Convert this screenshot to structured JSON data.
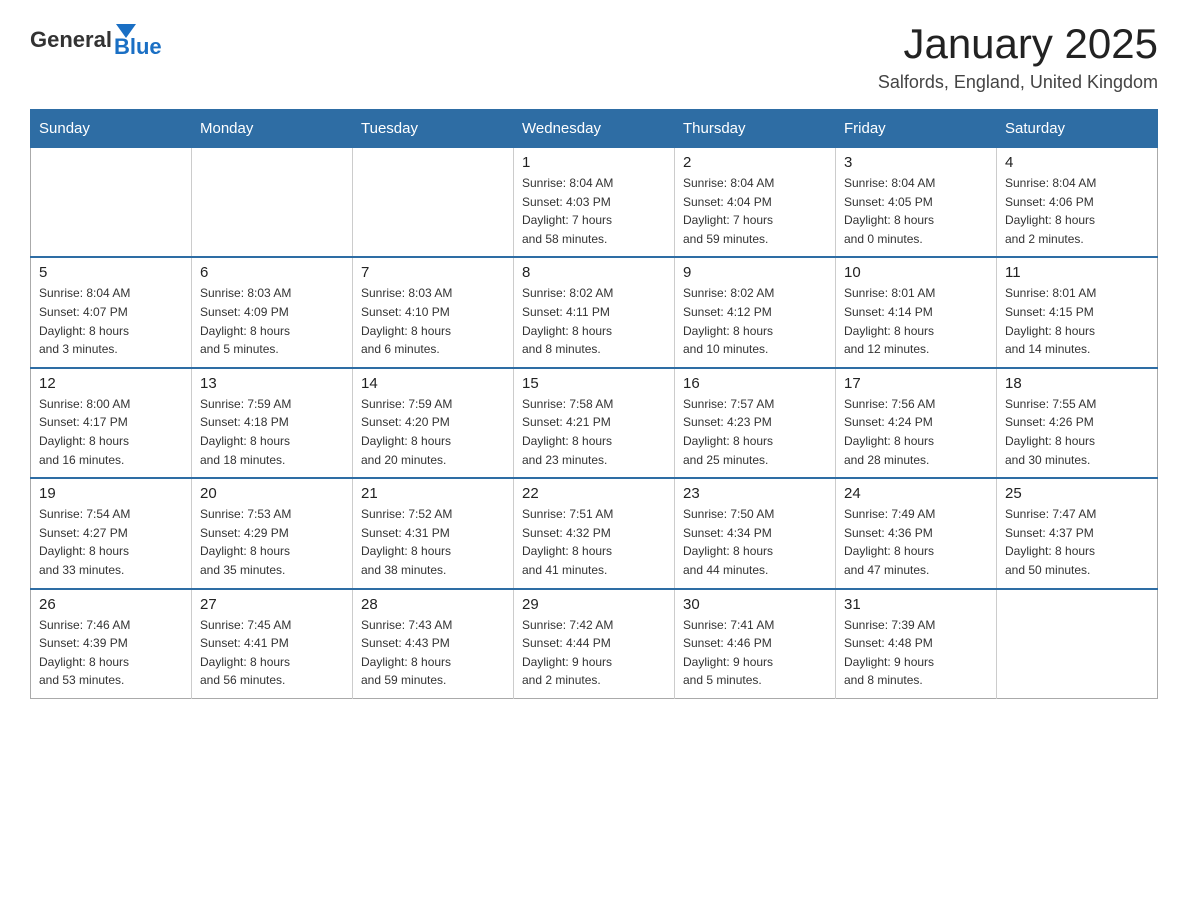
{
  "logo": {
    "general": "General",
    "blue": "Blue"
  },
  "title": "January 2025",
  "subtitle": "Salfords, England, United Kingdom",
  "days_of_week": [
    "Sunday",
    "Monday",
    "Tuesday",
    "Wednesday",
    "Thursday",
    "Friday",
    "Saturday"
  ],
  "weeks": [
    [
      {
        "day": "",
        "info": ""
      },
      {
        "day": "",
        "info": ""
      },
      {
        "day": "",
        "info": ""
      },
      {
        "day": "1",
        "info": "Sunrise: 8:04 AM\nSunset: 4:03 PM\nDaylight: 7 hours\nand 58 minutes."
      },
      {
        "day": "2",
        "info": "Sunrise: 8:04 AM\nSunset: 4:04 PM\nDaylight: 7 hours\nand 59 minutes."
      },
      {
        "day": "3",
        "info": "Sunrise: 8:04 AM\nSunset: 4:05 PM\nDaylight: 8 hours\nand 0 minutes."
      },
      {
        "day": "4",
        "info": "Sunrise: 8:04 AM\nSunset: 4:06 PM\nDaylight: 8 hours\nand 2 minutes."
      }
    ],
    [
      {
        "day": "5",
        "info": "Sunrise: 8:04 AM\nSunset: 4:07 PM\nDaylight: 8 hours\nand 3 minutes."
      },
      {
        "day": "6",
        "info": "Sunrise: 8:03 AM\nSunset: 4:09 PM\nDaylight: 8 hours\nand 5 minutes."
      },
      {
        "day": "7",
        "info": "Sunrise: 8:03 AM\nSunset: 4:10 PM\nDaylight: 8 hours\nand 6 minutes."
      },
      {
        "day": "8",
        "info": "Sunrise: 8:02 AM\nSunset: 4:11 PM\nDaylight: 8 hours\nand 8 minutes."
      },
      {
        "day": "9",
        "info": "Sunrise: 8:02 AM\nSunset: 4:12 PM\nDaylight: 8 hours\nand 10 minutes."
      },
      {
        "day": "10",
        "info": "Sunrise: 8:01 AM\nSunset: 4:14 PM\nDaylight: 8 hours\nand 12 minutes."
      },
      {
        "day": "11",
        "info": "Sunrise: 8:01 AM\nSunset: 4:15 PM\nDaylight: 8 hours\nand 14 minutes."
      }
    ],
    [
      {
        "day": "12",
        "info": "Sunrise: 8:00 AM\nSunset: 4:17 PM\nDaylight: 8 hours\nand 16 minutes."
      },
      {
        "day": "13",
        "info": "Sunrise: 7:59 AM\nSunset: 4:18 PM\nDaylight: 8 hours\nand 18 minutes."
      },
      {
        "day": "14",
        "info": "Sunrise: 7:59 AM\nSunset: 4:20 PM\nDaylight: 8 hours\nand 20 minutes."
      },
      {
        "day": "15",
        "info": "Sunrise: 7:58 AM\nSunset: 4:21 PM\nDaylight: 8 hours\nand 23 minutes."
      },
      {
        "day": "16",
        "info": "Sunrise: 7:57 AM\nSunset: 4:23 PM\nDaylight: 8 hours\nand 25 minutes."
      },
      {
        "day": "17",
        "info": "Sunrise: 7:56 AM\nSunset: 4:24 PM\nDaylight: 8 hours\nand 28 minutes."
      },
      {
        "day": "18",
        "info": "Sunrise: 7:55 AM\nSunset: 4:26 PM\nDaylight: 8 hours\nand 30 minutes."
      }
    ],
    [
      {
        "day": "19",
        "info": "Sunrise: 7:54 AM\nSunset: 4:27 PM\nDaylight: 8 hours\nand 33 minutes."
      },
      {
        "day": "20",
        "info": "Sunrise: 7:53 AM\nSunset: 4:29 PM\nDaylight: 8 hours\nand 35 minutes."
      },
      {
        "day": "21",
        "info": "Sunrise: 7:52 AM\nSunset: 4:31 PM\nDaylight: 8 hours\nand 38 minutes."
      },
      {
        "day": "22",
        "info": "Sunrise: 7:51 AM\nSunset: 4:32 PM\nDaylight: 8 hours\nand 41 minutes."
      },
      {
        "day": "23",
        "info": "Sunrise: 7:50 AM\nSunset: 4:34 PM\nDaylight: 8 hours\nand 44 minutes."
      },
      {
        "day": "24",
        "info": "Sunrise: 7:49 AM\nSunset: 4:36 PM\nDaylight: 8 hours\nand 47 minutes."
      },
      {
        "day": "25",
        "info": "Sunrise: 7:47 AM\nSunset: 4:37 PM\nDaylight: 8 hours\nand 50 minutes."
      }
    ],
    [
      {
        "day": "26",
        "info": "Sunrise: 7:46 AM\nSunset: 4:39 PM\nDaylight: 8 hours\nand 53 minutes."
      },
      {
        "day": "27",
        "info": "Sunrise: 7:45 AM\nSunset: 4:41 PM\nDaylight: 8 hours\nand 56 minutes."
      },
      {
        "day": "28",
        "info": "Sunrise: 7:43 AM\nSunset: 4:43 PM\nDaylight: 8 hours\nand 59 minutes."
      },
      {
        "day": "29",
        "info": "Sunrise: 7:42 AM\nSunset: 4:44 PM\nDaylight: 9 hours\nand 2 minutes."
      },
      {
        "day": "30",
        "info": "Sunrise: 7:41 AM\nSunset: 4:46 PM\nDaylight: 9 hours\nand 5 minutes."
      },
      {
        "day": "31",
        "info": "Sunrise: 7:39 AM\nSunset: 4:48 PM\nDaylight: 9 hours\nand 8 minutes."
      },
      {
        "day": "",
        "info": ""
      }
    ]
  ]
}
